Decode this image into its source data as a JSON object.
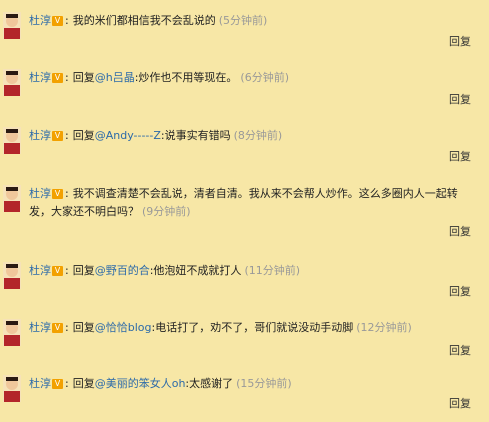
{
  "comments": [
    {
      "user": "杜淳",
      "colon": ":",
      "prefix": "",
      "mention": "",
      "text": "我的米们都相信我不会乱说的",
      "time": "(5分钟前)",
      "reply": "回复"
    },
    {
      "user": "杜淳",
      "colon": ":",
      "prefix": "回复",
      "mention": "@h吕晶",
      "text": ":炒作也不用等现在。",
      "time": "(6分钟前)",
      "reply": "回复"
    },
    {
      "user": "杜淳",
      "colon": ":",
      "prefix": "回复",
      "mention": "@Andy-----Z",
      "text": ":说事实有错吗",
      "time": "(8分钟前)",
      "reply": "回复"
    },
    {
      "user": "杜淳",
      "colon": ":",
      "prefix": "",
      "mention": "",
      "text": "我不调查清楚不会乱说，清者自清。我从来不会帮人炒作。这么多圈内人一起转发，大家还不明白吗？",
      "time": "(9分钟前)",
      "reply": "回复"
    },
    {
      "user": "杜淳",
      "colon": ":",
      "prefix": "回复",
      "mention": "@野百的合",
      "text": ":他泡妞不成就打人",
      "time": "(11分钟前)",
      "reply": "回复"
    },
    {
      "user": "杜淳",
      "colon": ":",
      "prefix": "回复",
      "mention": "@恰恰blog",
      "text": ":电话打了，劝不了，哥们就说没动手动脚",
      "time": "(12分钟前)",
      "reply": "回复"
    },
    {
      "user": "杜淳",
      "colon": ":",
      "prefix": "回复",
      "mention": "@美丽的笨女人oh",
      "text": ":太感谢了",
      "time": "(15分钟前)",
      "reply": "回复"
    }
  ],
  "colors": {
    "background": "#f7e7a6",
    "link": "#2c6aa9",
    "verified": "#f2a100",
    "timestamp": "#999999"
  },
  "icons": {
    "avatar": "avatar-icon",
    "verified": "verified-v-icon"
  }
}
